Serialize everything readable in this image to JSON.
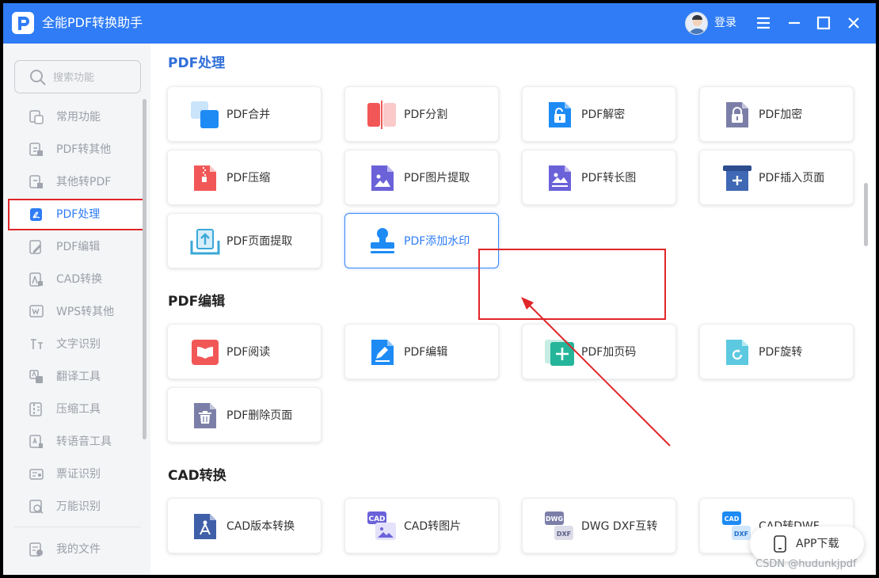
{
  "app": {
    "title": "全能PDF转换助手",
    "login_label": "登录"
  },
  "colors": {
    "brand": "#2f7cf6",
    "annotation": "#e0262a"
  },
  "search": {
    "placeholder": "搜索功能"
  },
  "sidebar": {
    "items": [
      {
        "label": "常用功能",
        "icon": "common-functions-icon"
      },
      {
        "label": "PDF转其他",
        "icon": "pdf-to-other-icon"
      },
      {
        "label": "其他转PDF",
        "icon": "other-to-pdf-icon"
      },
      {
        "label": "PDF处理",
        "icon": "pdf-process-icon",
        "active": true
      },
      {
        "label": "PDF编辑",
        "icon": "pdf-edit-icon"
      },
      {
        "label": "CAD转换",
        "icon": "cad-convert-icon"
      },
      {
        "label": "WPS转其他",
        "icon": "wps-convert-icon"
      },
      {
        "label": "文字识别",
        "icon": "ocr-icon"
      },
      {
        "label": "翻译工具",
        "icon": "translate-icon"
      },
      {
        "label": "压缩工具",
        "icon": "compress-tool-icon"
      },
      {
        "label": "转语音工具",
        "icon": "text-to-speech-icon"
      },
      {
        "label": "票证识别",
        "icon": "ticket-recognition-icon"
      },
      {
        "label": "万能识别",
        "icon": "universal-recognition-icon"
      }
    ],
    "my_files": {
      "label": "我的文件",
      "icon": "my-files-icon"
    }
  },
  "sections": [
    {
      "title": "PDF处理",
      "cards": [
        {
          "label": "PDF合并",
          "icon": "merge-icon"
        },
        {
          "label": "PDF分割",
          "icon": "split-icon"
        },
        {
          "label": "PDF解密",
          "icon": "unlock-icon"
        },
        {
          "label": "PDF加密",
          "icon": "lock-icon"
        },
        {
          "label": "PDF压缩",
          "icon": "zip-icon"
        },
        {
          "label": "PDF图片提取",
          "icon": "image-extract-icon"
        },
        {
          "label": "PDF转长图",
          "icon": "long-image-icon"
        },
        {
          "label": "PDF插入页面",
          "icon": "insert-page-icon"
        },
        {
          "label": "PDF页面提取",
          "icon": "page-extract-icon"
        },
        {
          "label": "PDF添加水印",
          "icon": "stamp-watermark-icon",
          "highlighted": true
        }
      ]
    },
    {
      "title": "PDF编辑",
      "cards": [
        {
          "label": "PDF阅读",
          "icon": "book-icon"
        },
        {
          "label": "PDF编辑",
          "icon": "edit-pen-icon"
        },
        {
          "label": "PDF加页码",
          "icon": "add-page-number-icon"
        },
        {
          "label": "PDF旋转",
          "icon": "rotate-icon"
        },
        {
          "label": "PDF删除页面",
          "icon": "trash-icon"
        }
      ]
    },
    {
      "title": "CAD转换",
      "cards": [
        {
          "label": "CAD版本转换",
          "icon": "compass-icon"
        },
        {
          "label": "CAD转图片",
          "icon": "cad-image-icon",
          "badge": "CAD"
        },
        {
          "label": "DWG DXF互转",
          "icon": "dwg-dxf-icon",
          "badge": "DWG",
          "badge2": "DXF"
        },
        {
          "label": "CAD转DWF",
          "icon": "cad-dwf-icon",
          "badge": "CAD",
          "badge2": "DXF"
        }
      ]
    }
  ],
  "app_download": {
    "label": "APP下载",
    "icon": "phone-icon"
  },
  "watermark": "CSDN @hudunkjpdf"
}
